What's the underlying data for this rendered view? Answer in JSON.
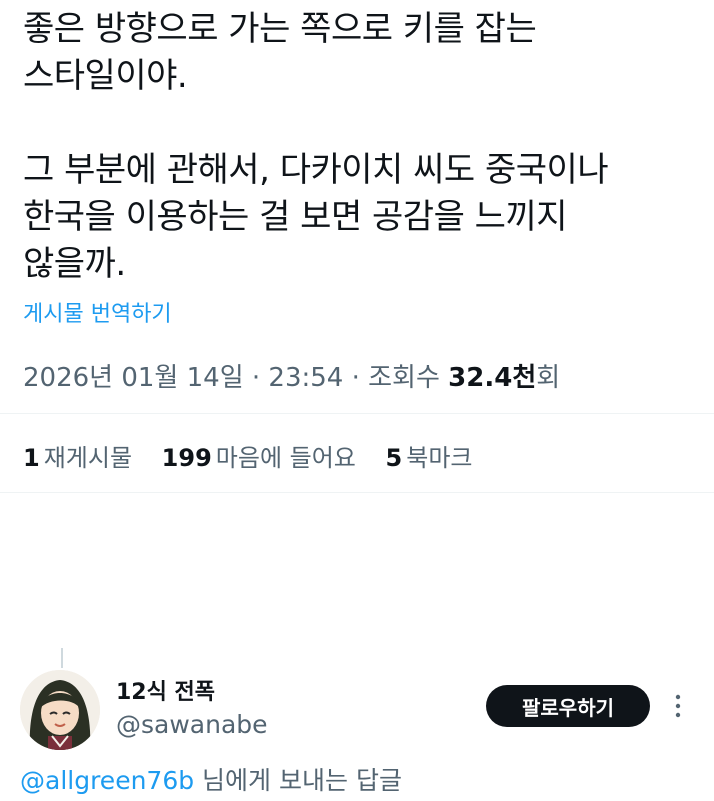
{
  "post": {
    "text_lines": [
      "좋은 방향으로 가는 쪽으로 키를 잡는",
      "스타일이야.",
      "",
      "그 부분에 관해서, 다카이치 씨도 중국이나",
      "한국을 이용하는 걸 보면 공감을 느끼지",
      "않을까."
    ],
    "translate_label": "게시물 번역하기",
    "timestamp": "2026년 01월 14일 · 23:54 · 조회수",
    "views_number": "32.4천",
    "views_suffix": "회"
  },
  "stats": {
    "reposts_count": "1",
    "reposts_label": "재게시물",
    "likes_count": "199",
    "likes_label": "마음에 들어요",
    "bookmarks_count": "5",
    "bookmarks_label": "북마크"
  },
  "reply": {
    "display_name": "12식 전폭",
    "handle": "@sawanabe",
    "follow_label": "팔로우하기",
    "reply_to_mention": "@allgreen76b",
    "reply_to_suffix": " 님에게 보내는 답글"
  },
  "colors": {
    "accent": "#1d9bf0",
    "text": "#0f1419",
    "secondary": "#536471",
    "follow_button": "#0f1419"
  },
  "icons": [
    "more-options-icon",
    "avatar"
  ]
}
